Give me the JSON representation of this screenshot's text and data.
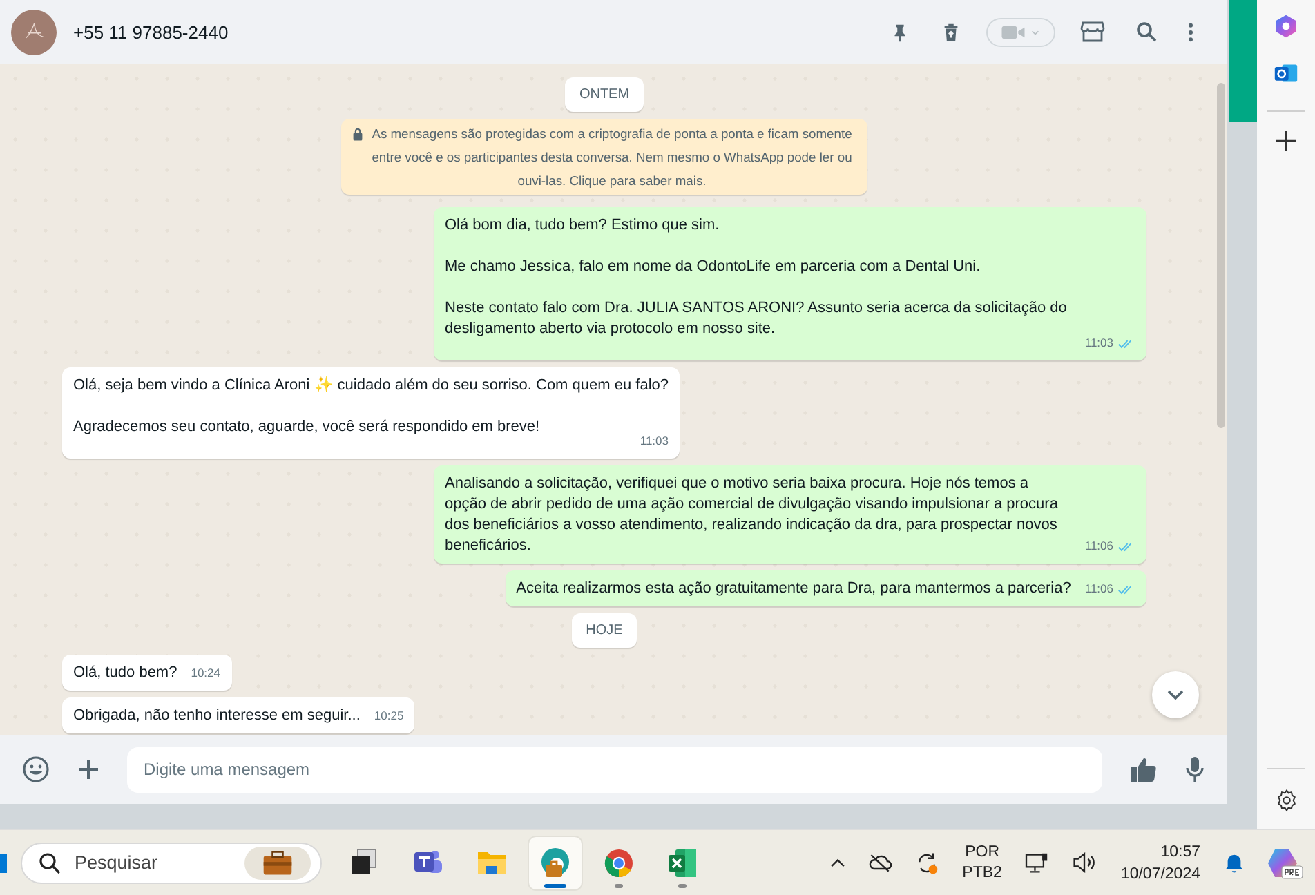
{
  "header": {
    "contact": "+55 11 97885-2440"
  },
  "chat": [
    {
      "kind": "date",
      "label": "ONTEM"
    },
    {
      "kind": "notice",
      "text": "As mensagens são protegidas com a criptografia de ponta a ponta e ficam somente entre você e os participantes desta conversa. Nem mesmo o WhatsApp pode ler ou ouvi-las. Clique para saber mais."
    },
    {
      "kind": "sent",
      "paragraphs": [
        "Olá bom dia, tudo bem? Estimo que sim.",
        "Me chamo Jessica, falo em nome da OdontoLife em parceria com a Dental Uni.",
        "Neste contato falo com Dra. JULIA SANTOS ARONI? Assunto seria acerca da solicitação do desligamento aberto via protocolo em nosso site."
      ],
      "time": "11:03",
      "read": true
    },
    {
      "kind": "received",
      "paragraphs": [
        "Olá, seja bem vindo a Clínica Aroni ✨ cuidado além do seu sorriso. Com quem eu falo?",
        "Agradecemos seu contato, aguarde, você será respondido em breve!"
      ],
      "time": "11:03"
    },
    {
      "kind": "sent",
      "paragraphs": [
        "Analisando a solicitação, verifiquei que o motivo seria baixa procura. Hoje nós temos a opção de abrir pedido de uma ação comercial de divulgação visando impulsionar a procura dos beneficiários a vosso atendimento, realizando indicação da dra, para prospectar novos beneficários."
      ],
      "time": "11:06",
      "read": true
    },
    {
      "kind": "sent",
      "paragraphs": [
        "Aceita realizarmos esta ação gratuitamente para Dra, para mantermos a parceria?"
      ],
      "time": "11:06",
      "read": true
    },
    {
      "kind": "date",
      "label": "HOJE"
    },
    {
      "kind": "received",
      "paragraphs": [
        "Olá, tudo bem?"
      ],
      "time": "10:24"
    },
    {
      "kind": "received",
      "paragraphs": [
        "Obrigada, não tenho interesse em seguir..."
      ],
      "time": "10:25"
    }
  ],
  "composer": {
    "placeholder": "Digite uma mensagem"
  },
  "taskbar": {
    "search_placeholder": "Pesquisar",
    "apps": [
      {
        "kind": "task-view",
        "selected": false,
        "running": false
      },
      {
        "kind": "teams",
        "selected": false,
        "running": false
      },
      {
        "kind": "files",
        "selected": false,
        "running": false
      },
      {
        "kind": "edge",
        "selected": true,
        "running": true
      },
      {
        "kind": "chrome",
        "selected": false,
        "running": true
      },
      {
        "kind": "excel",
        "selected": false,
        "running": true
      }
    ],
    "language": "POR",
    "layout": "PTB2",
    "time": "10:57",
    "date": "10/07/2024"
  }
}
